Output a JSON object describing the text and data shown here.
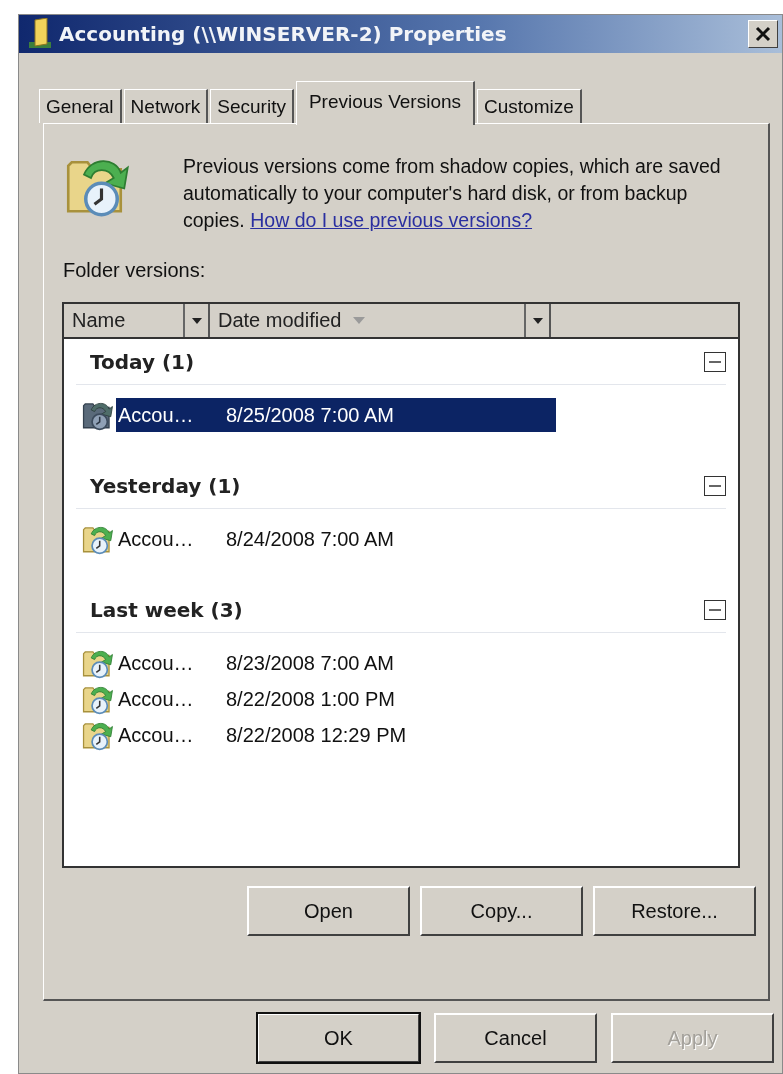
{
  "window": {
    "title": "Accounting (\\\\WINSERVER-2) Properties"
  },
  "tabs": [
    {
      "label": "General",
      "selected": false
    },
    {
      "label": "Network",
      "selected": false
    },
    {
      "label": "Security",
      "selected": false
    },
    {
      "label": "Previous Versions",
      "selected": true
    },
    {
      "label": "Customize",
      "selected": false
    }
  ],
  "description": {
    "text": "Previous versions come from shadow copies, which are saved automatically to your computer's hard disk, or from backup copies.",
    "link": "How do I use previous versions?"
  },
  "list_label": "Folder versions:",
  "columns": [
    {
      "label": "Name",
      "sorted": false
    },
    {
      "label": "Date modified",
      "sorted": true
    }
  ],
  "groups": [
    {
      "label": "Today (1)",
      "expanded": true,
      "items": [
        {
          "name": "Accou…",
          "date": "8/25/2008 7:00 AM",
          "selected": true
        }
      ]
    },
    {
      "label": "Yesterday (1)",
      "expanded": true,
      "items": [
        {
          "name": "Accou…",
          "date": "8/24/2008 7:00 AM",
          "selected": false
        }
      ]
    },
    {
      "label": "Last week (3)",
      "expanded": true,
      "items": [
        {
          "name": "Accou…",
          "date": "8/23/2008 7:00 AM",
          "selected": false
        },
        {
          "name": "Accou…",
          "date": "8/22/2008 1:00 PM",
          "selected": false
        },
        {
          "name": "Accou…",
          "date": "8/22/2008 12:29 PM",
          "selected": false
        }
      ]
    }
  ],
  "actions": [
    {
      "label": "Open"
    },
    {
      "label": "Copy..."
    },
    {
      "label": "Restore..."
    }
  ],
  "dialog_buttons": [
    {
      "label": "OK",
      "default": true,
      "disabled": false
    },
    {
      "label": "Cancel",
      "default": false,
      "disabled": false
    },
    {
      "label": "Apply",
      "default": false,
      "disabled": true
    }
  ]
}
